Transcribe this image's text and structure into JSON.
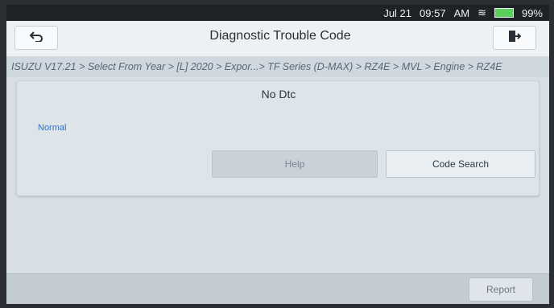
{
  "status_bar": {
    "date": "Jul 21",
    "time": "09:57",
    "ampm": "AM",
    "battery": "99%"
  },
  "header": {
    "title": "Diagnostic Trouble Code"
  },
  "breadcrumb": {
    "path": "ISUZU V17.21 > Select From Year > [L] 2020 > Expor...> TF Series (D-MAX) > RZ4E > MVL > Engine > RZ4E"
  },
  "panel": {
    "message": "No Dtc",
    "status_label": "Normal",
    "buttons": {
      "help": "Help",
      "code_search": "Code Search"
    }
  },
  "footer": {
    "report_label": "Report"
  },
  "icons": {
    "back": "back-arrow-icon",
    "exit": "exit-icon",
    "wifi": "wifi-icon",
    "battery": "battery-icon"
  },
  "colors": {
    "status_label": "#2f6fc0",
    "battery_fill": "#59d05a"
  }
}
